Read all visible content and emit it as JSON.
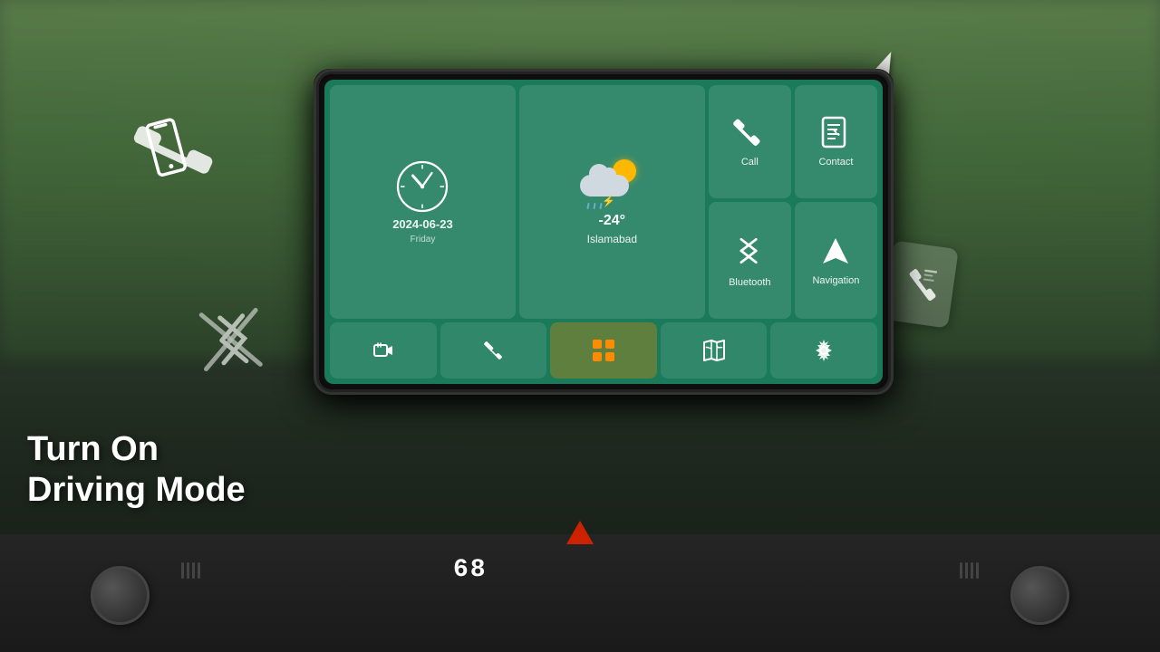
{
  "background": {
    "color": "#2a3a2a"
  },
  "screen": {
    "clock_tile": {
      "date": "2024-06-23",
      "day": "Friday"
    },
    "weather_tile": {
      "temp": "-24°",
      "city": "Islamabad"
    },
    "call_tile": {
      "label": "Call"
    },
    "contact_tile": {
      "label": "Contact"
    },
    "bluetooth_tile": {
      "label": "Bluetooth"
    },
    "navigation_tile": {
      "label": "Navigation"
    },
    "bottom_nav": {
      "back_icon": "⊣",
      "phone_icon": "✆",
      "apps_icon": "⊞",
      "map_icon": "🗺",
      "settings_icon": "⚙"
    }
  },
  "overlay_text": {
    "line1": "Turn On",
    "line2": "Driving Mode"
  },
  "dashboard": {
    "temperature": "68"
  },
  "colors": {
    "screen_bg": "#1a7a5a",
    "tile_bg": "rgba(255,255,255,0.12)",
    "accent_orange": "#FF8C00",
    "white": "#ffffff"
  }
}
